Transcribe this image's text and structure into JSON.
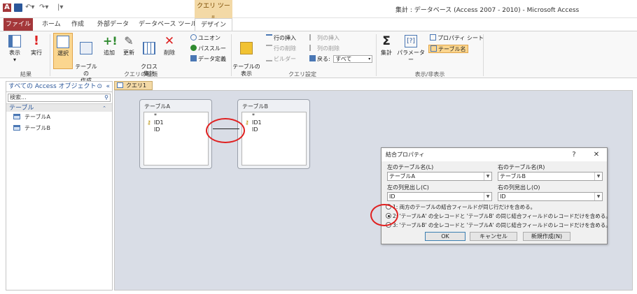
{
  "window": {
    "title": "集計 : データベース (Access 2007 - 2010) - Microsoft Access",
    "context_tab_header": "クエリ ツール",
    "app_icon_letter": "A"
  },
  "tabs": [
    "ファイル",
    "ホーム",
    "作成",
    "外部データ",
    "データベース ツール",
    "デザイン"
  ],
  "ribbon": {
    "results": {
      "view": "表示",
      "run": "実行",
      "label": "結果"
    },
    "query_type": {
      "select": "選択",
      "make_table": "テーブルの\n作成",
      "append": "追加",
      "update": "更新",
      "crosstab": "クロス\n集計",
      "delete": "削除",
      "union": "ユニオン",
      "passthrough": "パススルー",
      "data_definition": "データ定義",
      "label": "クエリの種類"
    },
    "setup": {
      "show_table": "テーブルの\n表示",
      "insert_rows": "行の挿入",
      "delete_rows": "行の削除",
      "builder": "ビルダー",
      "insert_columns": "列の挿入",
      "delete_columns": "列の削除",
      "return_label": "戻る:",
      "return_value": "すべて",
      "label": "クエリ設定"
    },
    "show_hide": {
      "totals": "集計",
      "parameters": "パラメーター",
      "property_sheet": "プロパティ シート",
      "table_names": "テーブル名",
      "label": "表示/非表示"
    }
  },
  "nav": {
    "header": "すべての Access オブジェクト",
    "search_placeholder": "検索...",
    "group": "テーブル",
    "items": [
      "テーブルA",
      "テーブルB"
    ]
  },
  "document": {
    "tab": "クエリ1",
    "tables": [
      {
        "name": "テーブルA",
        "fields": [
          "*",
          "ID1",
          "ID"
        ]
      },
      {
        "name": "テーブルB",
        "fields": [
          "*",
          "ID1",
          "ID"
        ]
      }
    ]
  },
  "dialog": {
    "title": "結合プロパティ",
    "help": "?",
    "close": "✕",
    "left_table_label": "左のテーブル名(L)",
    "left_table_value": "テーブルA",
    "right_table_label": "右のテーブル名(R)",
    "right_table_value": "テーブルB",
    "left_column_label": "左の列見出し(C)",
    "left_column_value": "ID",
    "right_column_label": "右の列見出し(O)",
    "right_column_value": "ID",
    "options": [
      "1:  両方のテーブルの結合フィールドが同じ行だけを含める。",
      "2:  'テーブルA' の全レコードと 'テーブルB' の同じ結合フィールドのレコードだけを含める。",
      "3:  'テーブルB' の全レコードと 'テーブルA' の同じ結合フィールドのレコードだけを含める。"
    ],
    "selected_option": 2,
    "ok": "OK",
    "cancel": "キャンセル",
    "new": "新規作成(N)"
  },
  "colors": {
    "accent": "#a4373a",
    "context": "#f3d9a6",
    "highlight": "#e02020"
  }
}
